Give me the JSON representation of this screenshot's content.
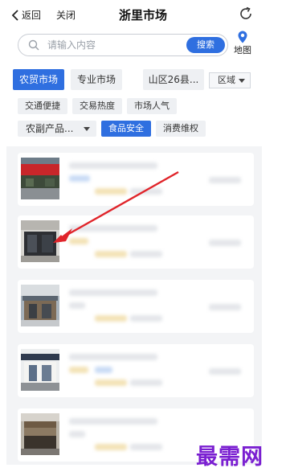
{
  "header": {
    "back_label": "返回",
    "close_label": "关闭",
    "title": "浙里市场"
  },
  "search": {
    "placeholder": "请输入内容",
    "button_label": "搜索",
    "map_label": "地图"
  },
  "filters": {
    "tabs": [
      "农贸市场",
      "专业市场"
    ],
    "active_tab": "农贸市场",
    "district": "山区26县...",
    "area_dropdown": "区域",
    "sort_chips": [
      "交通便捷",
      "交易热度",
      "市场人气"
    ],
    "category_dropdown": "农副产品...",
    "category_chips": [
      "食品安全",
      "消费维权"
    ],
    "active_category_chip": "食品安全"
  },
  "markets": {
    "count_visible": 5,
    "content_blurred": true
  },
  "watermark": "最需网",
  "colors": {
    "accent": "#2f6fe0",
    "arrow": "#e0242a",
    "watermark": "#7a1fd1",
    "chip_bg": "#eef0f3"
  }
}
